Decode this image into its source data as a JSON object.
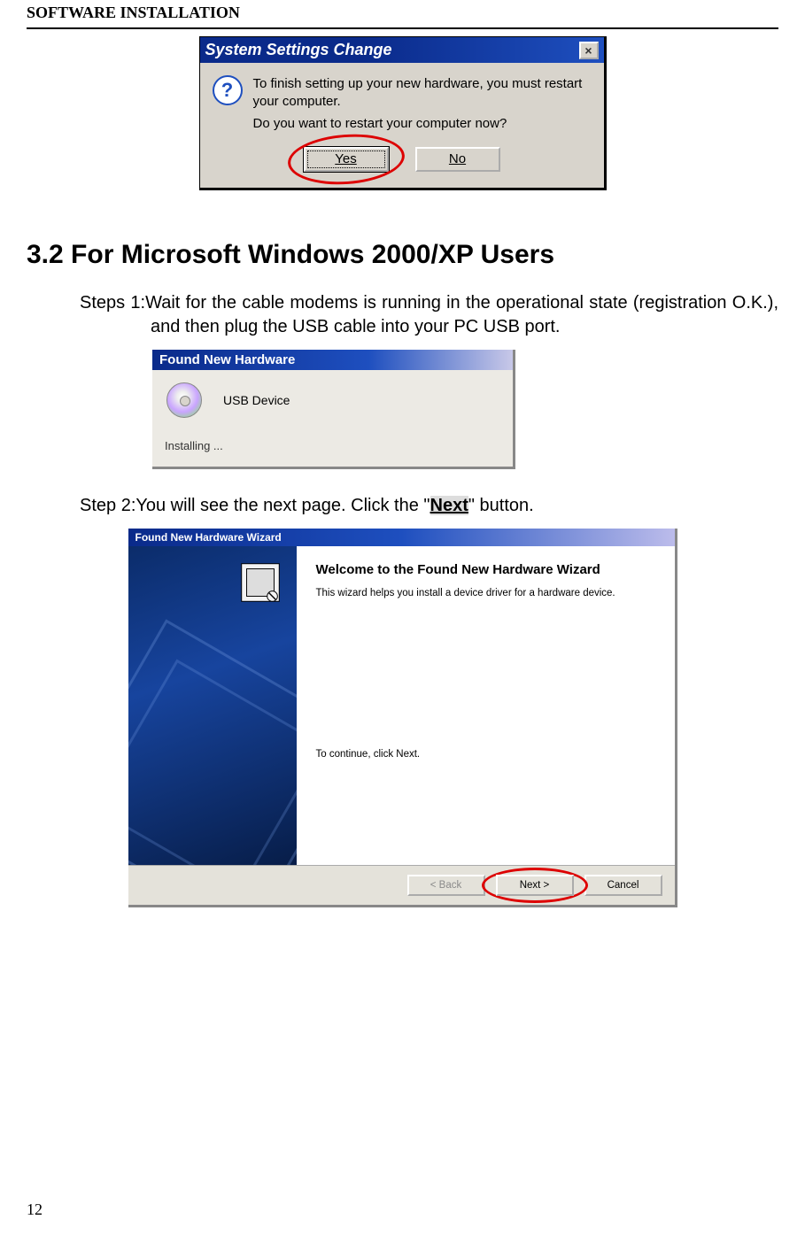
{
  "header": {
    "title": "SOFTWARE INSTALLATION"
  },
  "dialog1": {
    "title": "System Settings Change",
    "line1": "To finish setting up your new hardware, you must restart your computer.",
    "line2": "Do you want to restart your computer now?",
    "yes": "Yes",
    "no": "No",
    "close": "×"
  },
  "section_heading": "3.2 For Microsoft Windows 2000/XP Users",
  "step1": "Steps 1:Wait for the cable modems is running in the operational state (registration O.K.), and then plug the USB cable into your PC USB port.",
  "dialog2": {
    "title": "Found New Hardware",
    "device": "USB Device",
    "status": "Installing ..."
  },
  "step2_prefix": "Step 2:You will see the next page. Click the \"",
  "step2_hl": "Next",
  "step2_suffix": "\" button.",
  "dialog3": {
    "title": "Found New Hardware Wizard",
    "heading": "Welcome to the Found New Hardware Wizard",
    "desc": "This wizard helps you install a device driver for a hardware device.",
    "continue": "To continue, click Next.",
    "back": "< Back",
    "next": "Next >",
    "cancel": "Cancel"
  },
  "page_number": "12"
}
